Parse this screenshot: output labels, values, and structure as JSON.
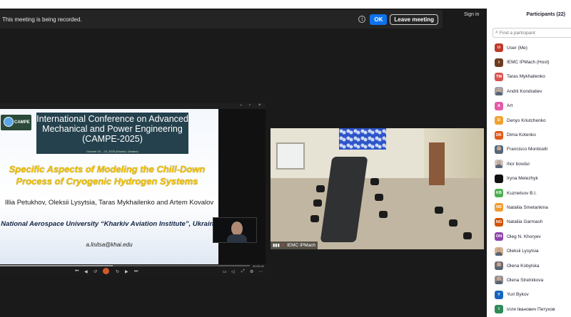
{
  "recording_bar": {
    "message": "This meeting is being recorded.",
    "info_icon": "info-icon",
    "ok_label": "OK",
    "leave_label": "Leave meeting"
  },
  "sign_in_label": "Sign in",
  "slide": {
    "logo_text": "CAMPE",
    "title": "International Conference on Advanced Mechanical and Power Engineering (CAMPE-2025)",
    "dates": "October 20 – 23, 2025 (Kharkiv, Ukraine)",
    "subtitle": "Specific Aspects of Modeling the Chill-Down Process of Cryogenic Hydrogen Systems",
    "authors": "Illia Petukhov, Oleksii Lysytsia, Taras Mykhailenko and Artem Kovalov",
    "university": "National Aerospace University “Kharkiv Aviation Institute”, Ukraine",
    "email": "a.lisitsa@khai.edu"
  },
  "video_player": {
    "progress": 0.45,
    "time": "00:09:18"
  },
  "room_camera": {
    "name": "IEMC IPMach"
  },
  "participants_panel": {
    "title": "Participants (22)",
    "search_placeholder": "Find a participant",
    "items": [
      {
        "initial": "U",
        "color": "#c0392b",
        "name": "User (Me)"
      },
      {
        "initial": "I",
        "color": "#6e3b1f",
        "name": "IEMC IPMach (Host)"
      },
      {
        "initial": "TM",
        "color": "#d9534f",
        "name": "Taras Mykhailenko"
      },
      {
        "initial": "",
        "color": "#9aa3ad",
        "name": "Andrii Kondratiev",
        "photo": true
      },
      {
        "initial": "A",
        "color": "#e35aa9",
        "name": "Art"
      },
      {
        "initial": "D",
        "color": "#f0a32e",
        "name": "Denys Kriutchenko"
      },
      {
        "initial": "DK",
        "color": "#e3571b",
        "name": "Dima Kotenko"
      },
      {
        "initial": "",
        "color": "#4a6a8a",
        "name": "Francisco Monticelli",
        "photo": true
      },
      {
        "initial": "",
        "color": "#c9c9c9",
        "name": "ihor bovdui",
        "photo": true
      },
      {
        "initial": "",
        "color": "#111111",
        "name": "Iryna Melezhyk"
      },
      {
        "initial": "KB",
        "color": "#4caf50",
        "name": "Kuznetsov B.I."
      },
      {
        "initial": "NS",
        "color": "#f39c2a",
        "name": "Nataliia Smetankina"
      },
      {
        "initial": "NG",
        "color": "#d35400",
        "name": "Nataliia Garmash"
      },
      {
        "initial": "ON",
        "color": "#8e44ad",
        "name": "Oleg N. Khoryev"
      },
      {
        "initial": "",
        "color": "#d7b28f",
        "name": "Oleksii Lysytsia",
        "photo": true
      },
      {
        "initial": "",
        "color": "#6b6f78",
        "name": "Olena Kobylska",
        "photo": true
      },
      {
        "initial": "",
        "color": "#8d8f96",
        "name": "Olena Strelnikova",
        "photo": true
      },
      {
        "initial": "Y",
        "color": "#1565c0",
        "name": "Yuri Bykov"
      },
      {
        "initial": "I",
        "color": "#2e8b57",
        "name": "Ілля Іванович Петухов"
      }
    ]
  }
}
